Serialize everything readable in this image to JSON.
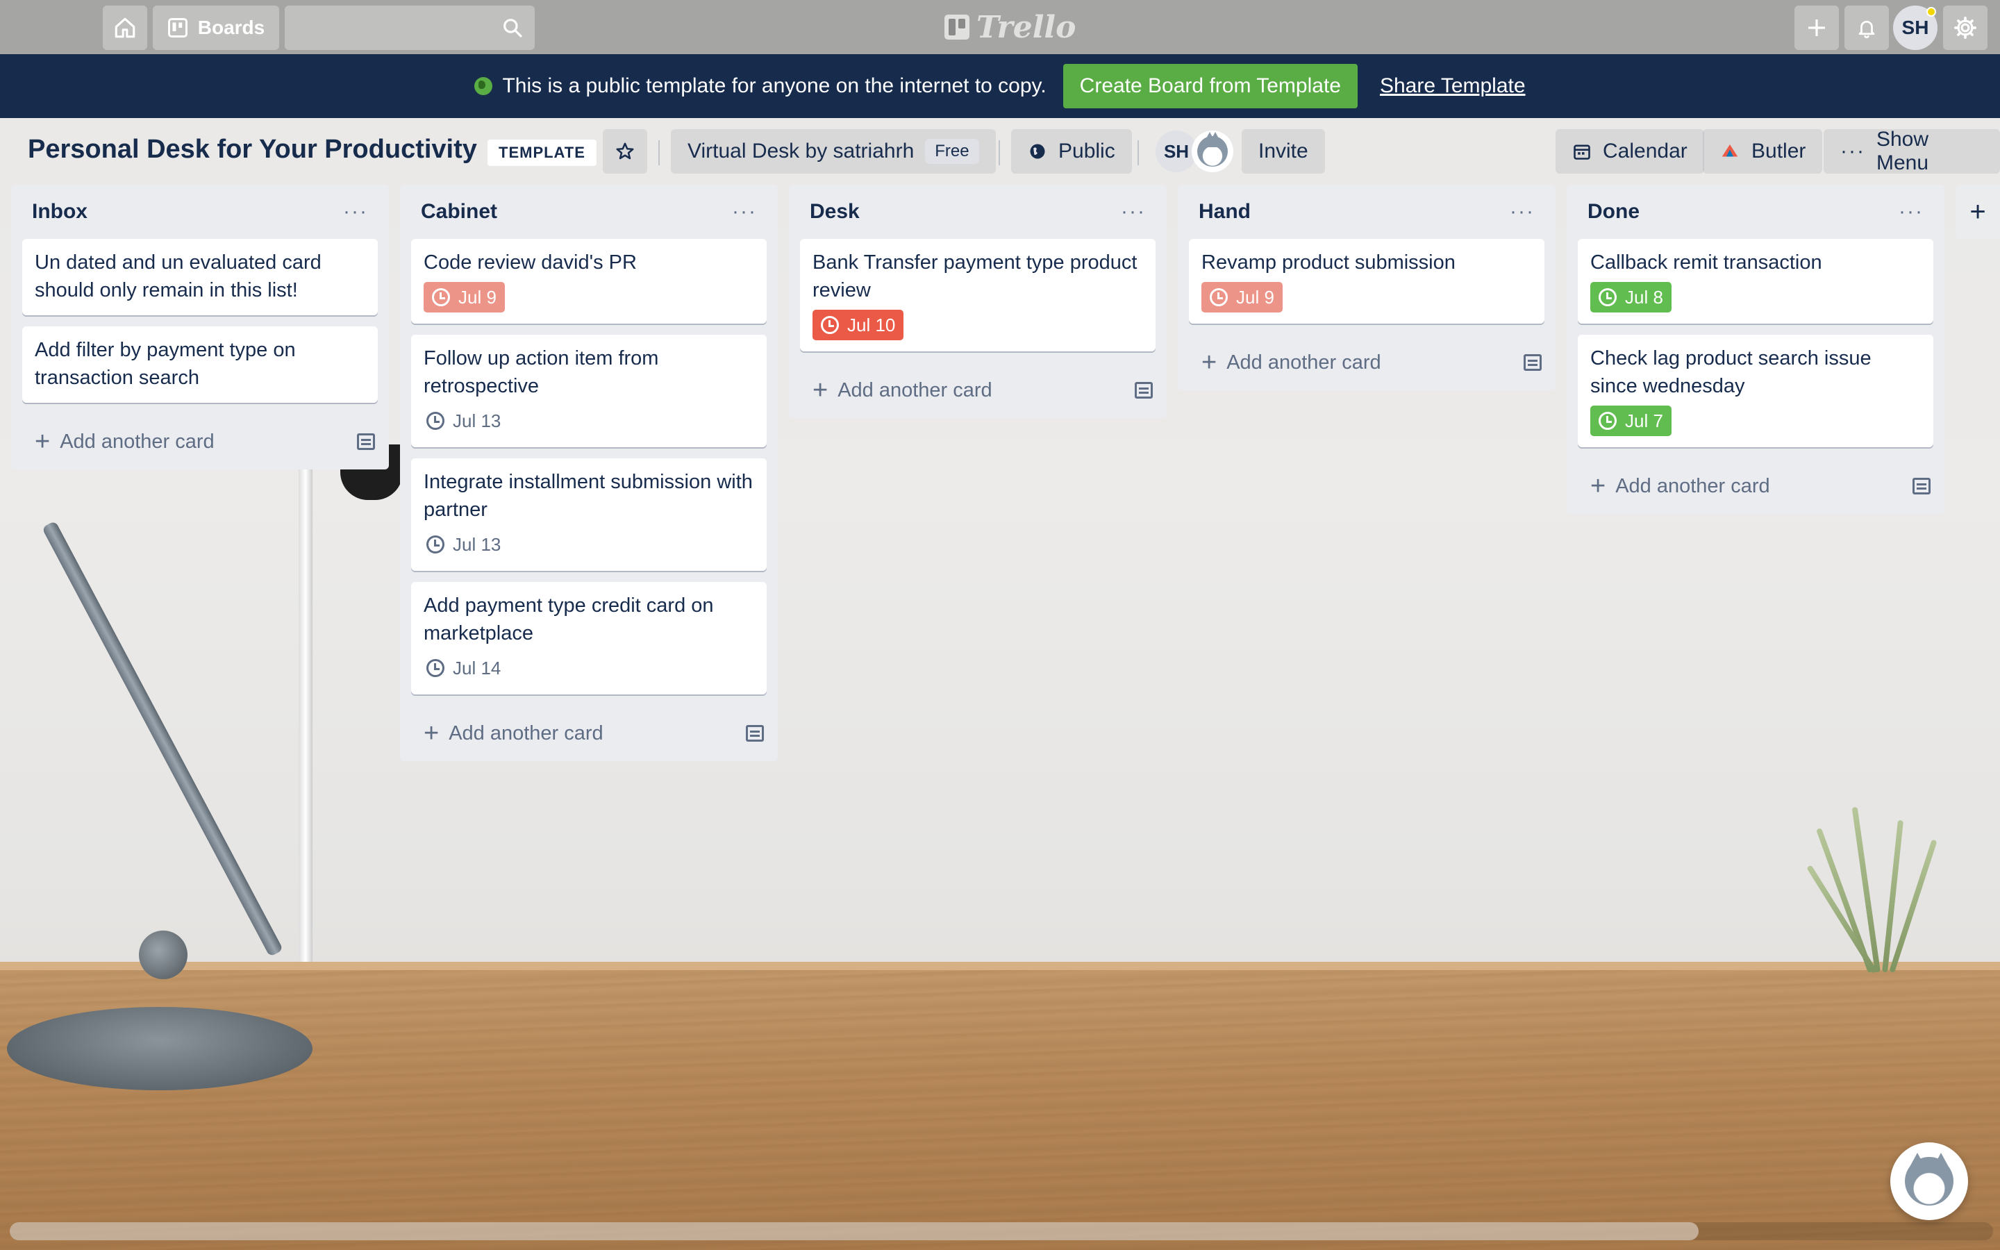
{
  "topbar": {
    "boards_label": "Boards",
    "logo_text": "Trello",
    "user_initials": "SH"
  },
  "banner": {
    "message": "This is a public template for anyone on the internet to copy.",
    "create_button": "Create Board from Template",
    "share_link": "Share Template"
  },
  "board": {
    "title": "Personal Desk for Your Productivity",
    "template_badge": "TEMPLATE",
    "workspace": "Virtual Desk by satriahrh",
    "workspace_plan": "Free",
    "visibility": "Public",
    "member_initials": "SH",
    "invite": "Invite",
    "calendar": "Calendar",
    "butler": "Butler",
    "show_menu": "Show Menu"
  },
  "lists": [
    {
      "title": "Inbox",
      "add_card": "Add another card",
      "cards": [
        {
          "title": "Un dated and un evaluated card should only remain in this list!",
          "due": null
        },
        {
          "title": "Add filter by payment type on transaction search",
          "due": null
        }
      ]
    },
    {
      "title": "Cabinet",
      "add_card": "Add another card",
      "cards": [
        {
          "title": "Code review david's PR",
          "due": "Jul 9",
          "due_style": "red-light"
        },
        {
          "title": "Follow up action item from retrospective",
          "due": "Jul 13",
          "due_style": "plain"
        },
        {
          "title": "Integrate installment submission with partner",
          "due": "Jul 13",
          "due_style": "plain"
        },
        {
          "title": "Add payment type credit card on marketplace",
          "due": "Jul 14",
          "due_style": "plain"
        }
      ]
    },
    {
      "title": "Desk",
      "add_card": "Add another card",
      "cards": [
        {
          "title": "Bank Transfer payment type product review",
          "due": "Jul 10",
          "due_style": "red"
        }
      ]
    },
    {
      "title": "Hand",
      "add_card": "Add another card",
      "cards": [
        {
          "title": "Revamp product submission",
          "due": "Jul 9",
          "due_style": "red-light"
        }
      ]
    },
    {
      "title": "Done",
      "add_card": "Add another card",
      "cards": [
        {
          "title": "Callback remit transaction",
          "due": "Jul 8",
          "due_style": "green"
        },
        {
          "title": "Check lag product search issue since wednesday",
          "due": "Jul 7",
          "due_style": "green"
        }
      ]
    }
  ],
  "colors": {
    "banner_bg": "#172b4d",
    "accent_green": "#5aac44",
    "due_red": "#eb5a46",
    "due_red_light": "#ec9488",
    "due_green": "#61bd4f",
    "list_bg": "#ebecf0"
  }
}
